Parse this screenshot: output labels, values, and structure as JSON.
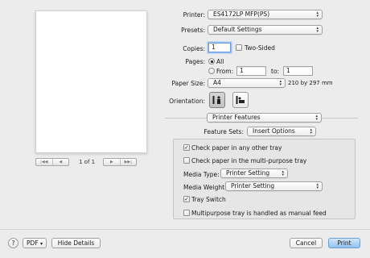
{
  "preview": {
    "page_indicator": "1 of 1",
    "nav_icons": [
      "first-page-icon",
      "previous-page-icon",
      "next-page-icon",
      "last-page-icon"
    ]
  },
  "printer": {
    "label": "Printer:",
    "value": "ES4172LP MFP(PS)"
  },
  "presets": {
    "label": "Presets:",
    "value": "Default Settings"
  },
  "copies": {
    "label": "Copies:",
    "value": "1",
    "two_sided_label": "Two-Sided",
    "two_sided_checked": false
  },
  "pages": {
    "label": "Pages:",
    "all_label": "All",
    "from_label": "From:",
    "from_value": "1",
    "to_label": "to:",
    "to_value": "1",
    "selected": "All"
  },
  "paper_size": {
    "label": "Paper Size:",
    "value": "A4",
    "dimensions": "210 by 297 mm"
  },
  "orientation": {
    "label": "Orientation:",
    "selected": "portrait",
    "icons": [
      "portrait-orientation-icon",
      "landscape-orientation-icon"
    ]
  },
  "section_popup": {
    "value": "Printer Features"
  },
  "feature_sets": {
    "label": "Feature Sets:",
    "value": "Insert Options"
  },
  "features": {
    "check_other_tray": {
      "label": "Check paper in any other tray",
      "checked": true
    },
    "check_multi_tray": {
      "label": "Check paper in the multi-purpose tray",
      "checked": false
    },
    "media_type": {
      "label": "Media Type:",
      "value": "Printer Setting"
    },
    "media_weight": {
      "label": "Media Weight:",
      "value": "Printer Setting"
    },
    "tray_switch": {
      "label": "Tray Switch",
      "checked": true
    },
    "manual_feed": {
      "label": "Multipurpose tray is handled as manual feed",
      "checked": false
    }
  },
  "footer": {
    "help_label": "?",
    "pdf_label": "PDF",
    "hide_details_label": "Hide Details",
    "cancel_label": "Cancel",
    "print_label": "Print"
  },
  "glyphs": {
    "popup_up": "▴",
    "popup_down": "▾",
    "check": "✓",
    "pdf_arrow": "▾"
  }
}
